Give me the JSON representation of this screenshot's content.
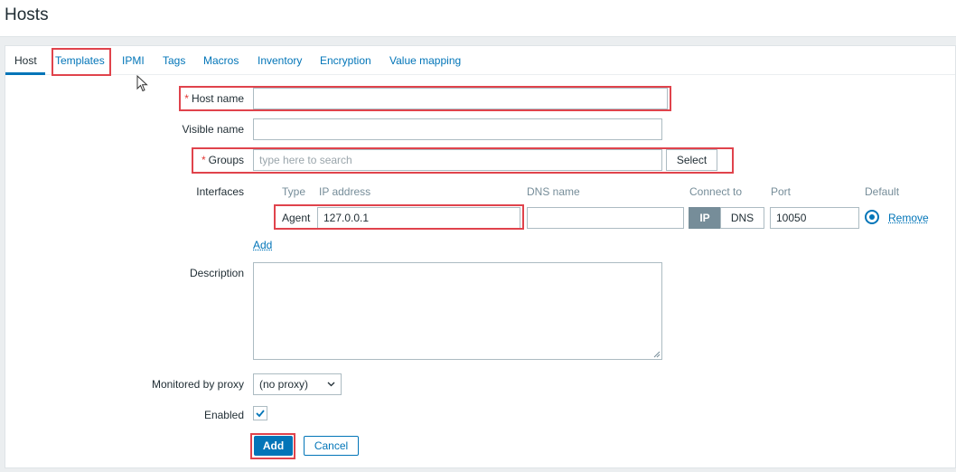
{
  "page": {
    "title": "Hosts"
  },
  "tabs": [
    {
      "label": "Host",
      "active": true
    },
    {
      "label": "Templates"
    },
    {
      "label": "IPMI"
    },
    {
      "label": "Tags"
    },
    {
      "label": "Macros"
    },
    {
      "label": "Inventory"
    },
    {
      "label": "Encryption"
    },
    {
      "label": "Value mapping"
    }
  ],
  "form": {
    "host_name": {
      "label": "Host name",
      "value": ""
    },
    "visible_name": {
      "label": "Visible name",
      "value": ""
    },
    "groups": {
      "label": "Groups",
      "placeholder": "type here to search",
      "select_label": "Select"
    },
    "interfaces": {
      "label": "Interfaces",
      "headers": {
        "type": "Type",
        "ip": "IP address",
        "dns": "DNS name",
        "connect": "Connect to",
        "port": "Port",
        "default": "Default"
      },
      "row": {
        "type": "Agent",
        "ip": "127.0.0.1",
        "dns": "",
        "connect_ip": "IP",
        "connect_dns": "DNS",
        "port": "10050",
        "remove": "Remove"
      },
      "add_label": "Add"
    },
    "description": {
      "label": "Description",
      "value": ""
    },
    "proxy": {
      "label": "Monitored by proxy",
      "value": "(no proxy)"
    },
    "enabled": {
      "label": "Enabled",
      "checked": true
    },
    "buttons": {
      "add": "Add",
      "cancel": "Cancel"
    }
  },
  "colors": {
    "accent": "#0275b8",
    "highlight": "#e0434c",
    "required": "#e33734"
  }
}
